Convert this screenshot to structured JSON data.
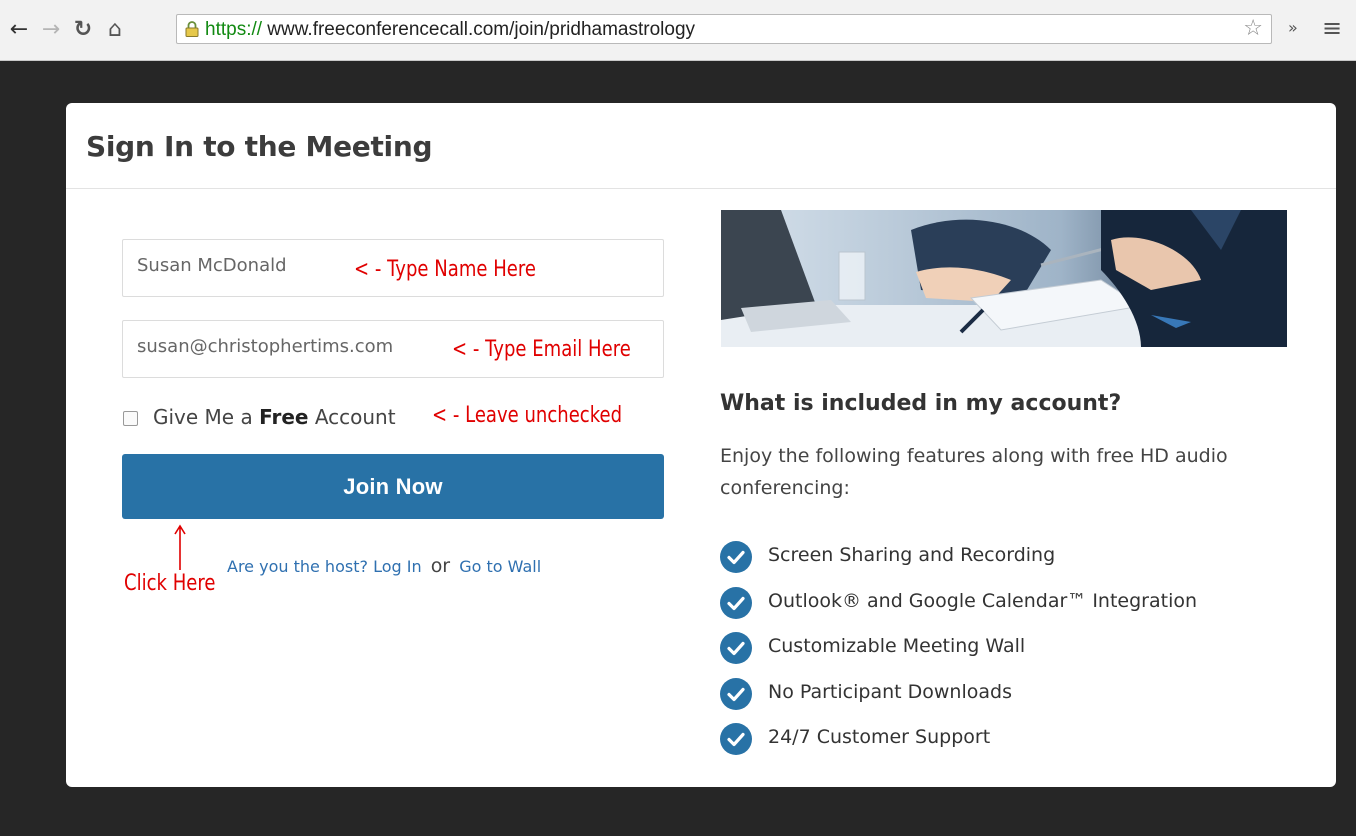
{
  "browser": {
    "url_scheme": "https://",
    "url_rest": " www.freeconferencecall.com/join/pridhamastrology",
    "icons": [
      "back-arrow-icon",
      "forward-arrow-icon",
      "reload-icon",
      "home-icon",
      "lock-icon",
      "star-icon",
      "overflow-icon",
      "menu-icon"
    ]
  },
  "card": {
    "title": "Sign In to the Meeting"
  },
  "form": {
    "name_value": "Susan McDonald",
    "email_value": "susan@christophertims.com",
    "checkbox_prefix": "Give Me a ",
    "checkbox_bold": "Free",
    "checkbox_suffix": " Account",
    "checkbox_checked": false,
    "join_label": "Join Now",
    "host_prompt": "Are you the host?",
    "login_label": "Log In",
    "or_label": "or",
    "wall_label": "Go to Wall"
  },
  "annotations": {
    "name_note": "< - Type Name Here",
    "email_note": "< - Type Email Here",
    "checkbox_note": "< - Leave unchecked",
    "click_note": "Click Here",
    "color": "#e00000"
  },
  "features": {
    "title": "What is included in my account?",
    "description": "Enjoy the following features along with free HD audio conferencing:",
    "items": [
      "Screen Sharing and Recording",
      "Outlook® and Google Calendar™ Integration",
      "Customizable Meeting Wall",
      "No Participant Downloads",
      "24/7 Customer Support"
    ]
  },
  "colors": {
    "accent": "#2872a6",
    "link": "#2f70b0",
    "background": "#262626"
  }
}
